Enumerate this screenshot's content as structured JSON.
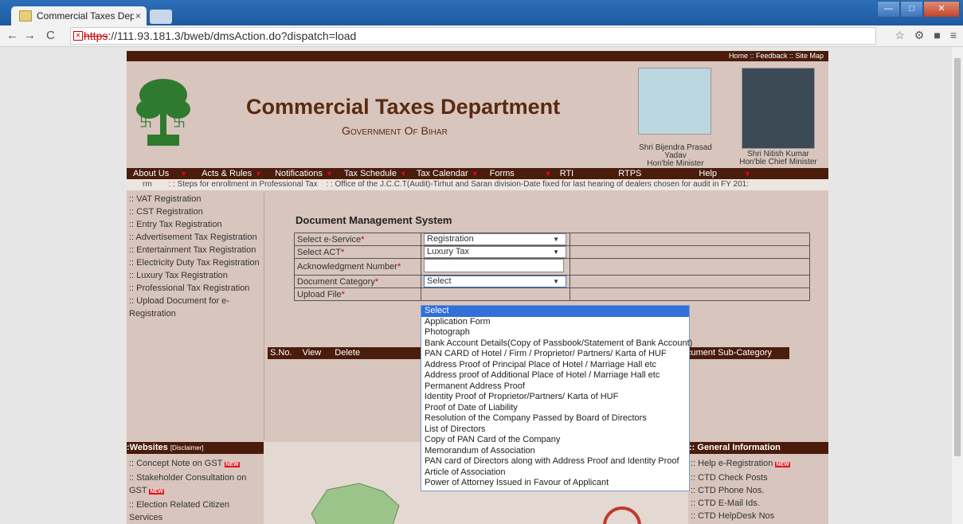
{
  "browser": {
    "tab_title": "Commercial Taxes Depart",
    "tab_close": "×",
    "url_scheme": "https",
    "url_rest": "://111.93.181.3/bweb/dmsAction.do?dispatch=load"
  },
  "site": {
    "toplinks": "Home :: Feedback :: Site Map",
    "title": "Commercial Taxes Department",
    "subtitle": "Government Of Bihar",
    "minister_caption": "Shri Bijendra Prasad Yadav",
    "minister_role": "Hon'ble Minister",
    "cm_caption": "Shri Nitish Kumar",
    "cm_role": "Hon'ble Chief Minister",
    "menu": [
      "About Us",
      "Acts & Rules",
      "Notifications",
      "Tax Schedule",
      "Tax Calendar",
      "Forms",
      "RTI",
      "RTPS",
      "Help"
    ],
    "ticker_lead": "rm",
    "ticker_sep1": ": :",
    "ticker_item1": "Steps for enrollment in Professional Tax",
    "ticker_sep2": ": :",
    "ticker_item2": "Office of the J.C.C.T(Audit)-Tirhut and Saran division-Date fixed for last hearing of dealers chosen for audit in FY 201:"
  },
  "left_links": [
    ":: VAT Registration",
    ":: CST Registration",
    ":: Entry Tax Registration",
    ":: Advertisement Tax Registration",
    ":: Entertainment Tax Registration",
    ":: Electricity Duty Tax Registration",
    ":: Luxury Tax Registration",
    ":: Professional Tax Registration",
    ":: Upload Document for e-Registration"
  ],
  "dms": {
    "heading": "Document Management System",
    "labels": {
      "eservice": "Select e-Service",
      "act": "Select ACT",
      "ack": "Acknowledgment Number",
      "category": "Document Category",
      "upload": "Upload File"
    },
    "req": "*",
    "values": {
      "eservice": "Registration",
      "act": "Luxury Tax",
      "category": "Select"
    },
    "grid_cols": [
      "S.No.",
      "View",
      "Delete",
      "cument Sub-Category"
    ]
  },
  "dropdown_options": [
    "Select",
    "Application Form",
    "Photograph",
    "Bank Account Details(Copy of Passbook/Statement of Bank Account)",
    "PAN CARD of Hotel / Firm / Proprietor/ Partners/ Karta of HUF",
    "Address Proof of Principal Place of Hotel / Marriage Hall etc",
    "Address proof of Additional Place of Hotel / Marriage Hall etc",
    "Permanent Address Proof",
    "Identity Proof of Proprietor/Partners/ Karta of HUF",
    "Proof of Date of Liability",
    "Resolution of the Company Passed by Board of Directors",
    "List of Directors",
    "Copy of PAN Card of the Company",
    "Memorandum of Association",
    "PAN card of Directors along with Address Proof and Identity Proof",
    "Article of Association",
    "Power of Attorney Issued in Favour of Applicant"
  ],
  "websites": {
    "heading": ":Websites",
    "disclaimer": "[Disclaimer]",
    "links": [
      ":: Concept Note on GST",
      ":: Stakeholder Consultation on GST",
      ":: Election Related Citizen Services"
    ]
  },
  "general": {
    "heading": ":: General Information",
    "links": [
      ":: Help e-Registration",
      ":: CTD Check Posts",
      ":: CTD Phone Nos.",
      ":: CTD E-Mail Ids.",
      ":: CTD HelpDesk Nos"
    ]
  },
  "new_badge": "NEW",
  "colors": {
    "brown": "#4a1c0c",
    "bg": "#d8c5bd",
    "title": "#5a2a10",
    "select_blue": "#3070d8"
  }
}
